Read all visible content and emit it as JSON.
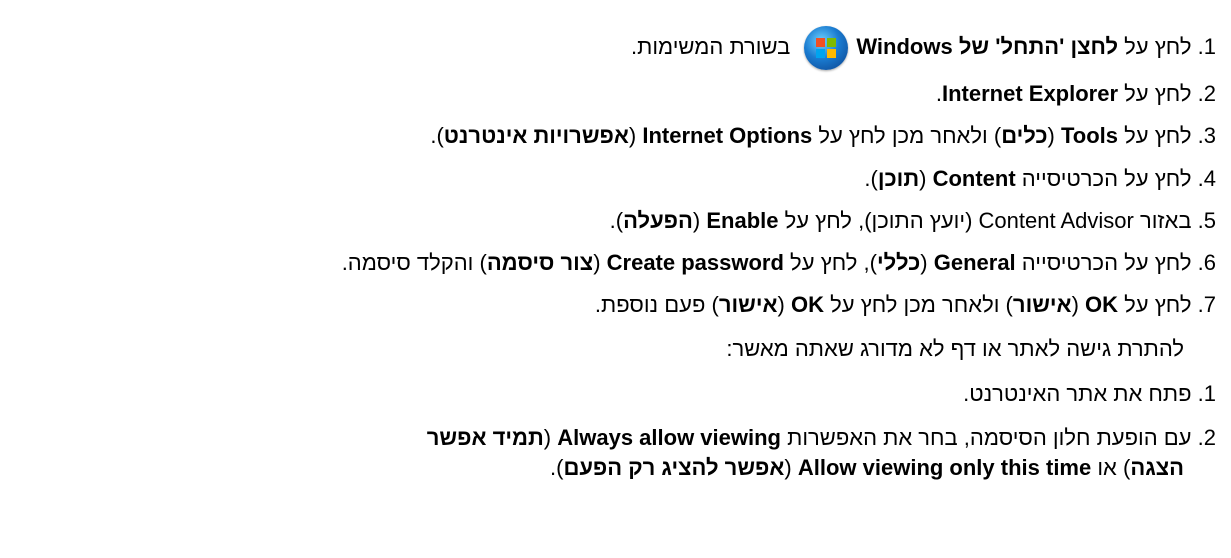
{
  "top_fragment": "(",
  "steps1": [
    {
      "n": "1.",
      "parts": [
        "לחץ על ",
        "לחצן 'התחל' של Windows",
        " בשורת המשימות."
      ]
    },
    {
      "n": "2.",
      "parts": [
        "לחץ על ",
        "Internet Explorer",
        "."
      ]
    },
    {
      "n": "3.",
      "parts": [
        "לחץ על ",
        "Tools",
        " (",
        "כלים",
        ") ולאחר מכן לחץ על ",
        "Internet Options",
        " (",
        "אפשרויות אינטרנט",
        ")."
      ]
    },
    {
      "n": "4.",
      "parts": [
        "לחץ על הכרטיסייה ",
        "Content",
        " (",
        "תוכן",
        ")."
      ]
    },
    {
      "n": "5.",
      "parts": [
        "באזור Content Advisor (יועץ התוכן), לחץ על ",
        "Enable",
        " (",
        "הפעלה",
        ")."
      ]
    },
    {
      "n": "6.",
      "parts": [
        "לחץ על הכרטיסייה ",
        "General",
        " (",
        "כללי",
        "), לחץ על ",
        "Create password",
        " (",
        "צור סיסמה",
        ") והקלד סיסמה."
      ]
    },
    {
      "n": "7.",
      "parts": [
        "לחץ על ",
        "OK",
        " (",
        "אישור",
        ") ולאחר מכן לחץ על ",
        "OK",
        " (",
        "אישור",
        ") פעם נוספת."
      ]
    }
  ],
  "intro2": "להתרת גישה לאתר או דף לא מדורג שאתה מאשר:",
  "steps2": [
    {
      "n": "1.",
      "parts": [
        "פתח את אתר האינטרנט."
      ]
    },
    {
      "n": "2.",
      "parts": [
        "עם הופעת חלון הסיסמה, בחר את האפשרות ",
        "Always allow viewing",
        " (",
        "תמיד אפשר"
      ]
    },
    {
      "n": "",
      "parts": [
        "הצגה",
        ") או ",
        "Allow viewing only this time",
        " (",
        "אפשר להציג רק הפעם",
        ")."
      ]
    }
  ],
  "icon": "windows-start-orb-icon"
}
